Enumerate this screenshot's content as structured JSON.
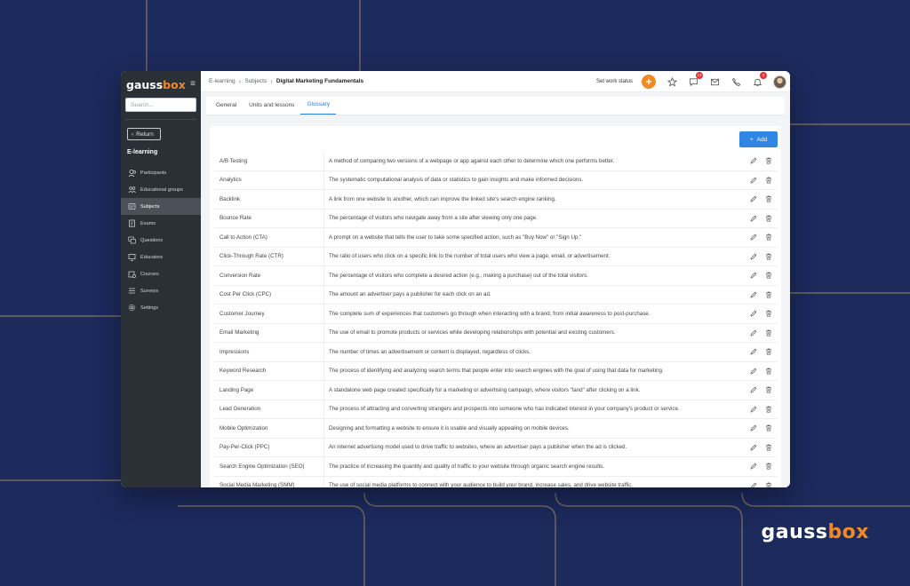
{
  "brand": {
    "name_main": "gauss",
    "name_accent": "box"
  },
  "sidebar": {
    "search_placeholder": "Search...",
    "return_label": "Return",
    "section_title": "E-learning",
    "items": [
      {
        "label": "Participants",
        "icon": "participants-icon",
        "active": false
      },
      {
        "label": "Educational groups",
        "icon": "groups-icon",
        "active": false
      },
      {
        "label": "Subjects",
        "icon": "subjects-icon",
        "active": true
      },
      {
        "label": "Exams",
        "icon": "exams-icon",
        "active": false
      },
      {
        "label": "Questions",
        "icon": "questions-icon",
        "active": false
      },
      {
        "label": "Educators",
        "icon": "educators-icon",
        "active": false
      },
      {
        "label": "Courses",
        "icon": "courses-icon",
        "active": false
      },
      {
        "label": "Surveys",
        "icon": "surveys-icon",
        "active": false
      },
      {
        "label": "Settings",
        "icon": "settings-icon",
        "active": false
      }
    ]
  },
  "header": {
    "breadcrumb": [
      "E-learning",
      "Subjects",
      "Digital Marketing Fundamentals"
    ],
    "work_status_label": "Set work status",
    "chat_badge": "12",
    "notification_badge": "3"
  },
  "tabs": [
    {
      "label": "General",
      "active": false
    },
    {
      "label": "Units and lessons",
      "active": false
    },
    {
      "label": "Glossary",
      "active": true
    }
  ],
  "glossary": {
    "add_label": "Add",
    "entries": [
      {
        "term": "A/B Testing",
        "definition": "A method of comparing two versions of a webpage or app against each other to determine which one performs better."
      },
      {
        "term": "Analytics",
        "definition": "The systematic computational analysis of data or statistics to gain insights and make informed decisions."
      },
      {
        "term": "Backlink",
        "definition": "A link from one website to another, which can improve the linked site's search engine ranking."
      },
      {
        "term": "Bounce Rate",
        "definition": "The percentage of visitors who navigate away from a site after viewing only one page."
      },
      {
        "term": "Call to Action (CTA)",
        "definition": "A prompt on a website that tells the user to take some specified action, such as \"Buy Now\" or \"Sign Up.\""
      },
      {
        "term": "Click-Through Rate (CTR)",
        "definition": "The ratio of users who click on a specific link to the number of total users who view a page, email, or advertisement."
      },
      {
        "term": "Conversion Rate",
        "definition": "The percentage of visitors who complete a desired action (e.g., making a purchase) out of the total visitors."
      },
      {
        "term": "Cost Per Click (CPC)",
        "definition": "The amount an advertiser pays a publisher for each click on an ad."
      },
      {
        "term": "Customer Journey",
        "definition": "The complete sum of experiences that customers go through when interacting with a brand, from initial awareness to post-purchase."
      },
      {
        "term": "Email Marketing",
        "definition": "The use of email to promote products or services while developing relationships with potential and existing customers."
      },
      {
        "term": "Impressions",
        "definition": "The number of times an advertisement or content is displayed, regardless of clicks."
      },
      {
        "term": "Keyword Research",
        "definition": "The process of identifying and analyzing search terms that people enter into search engines with the goal of using that data for marketing."
      },
      {
        "term": "Landing Page",
        "definition": "A standalone web page created specifically for a marketing or advertising campaign, where visitors \"land\" after clicking on a link."
      },
      {
        "term": "Lead Generation",
        "definition": "The process of attracting and converting strangers and prospects into someone who has indicated interest in your company's product or service."
      },
      {
        "term": "Mobile Optimization",
        "definition": "Designing and formatting a website to ensure it is usable and visually appealing on mobile devices."
      },
      {
        "term": "Pay-Per-Click (PPC)",
        "definition": "An internet advertising model used to drive traffic to websites, where an advertiser pays a publisher when the ad is clicked."
      },
      {
        "term": "Search Engine Optimization (SEO)",
        "definition": "The practice of increasing the quantity and quality of traffic to your website through organic search engine results."
      },
      {
        "term": "Social Media Marketing (SMM)",
        "definition": "The use of social media platforms to connect with your audience to build your brand, increase sales, and drive website traffic."
      }
    ]
  },
  "colors": {
    "accent": "#f08a24",
    "primary": "#2f86e4",
    "background": "#1c2a5c",
    "sidebar": "#2b2f36"
  }
}
